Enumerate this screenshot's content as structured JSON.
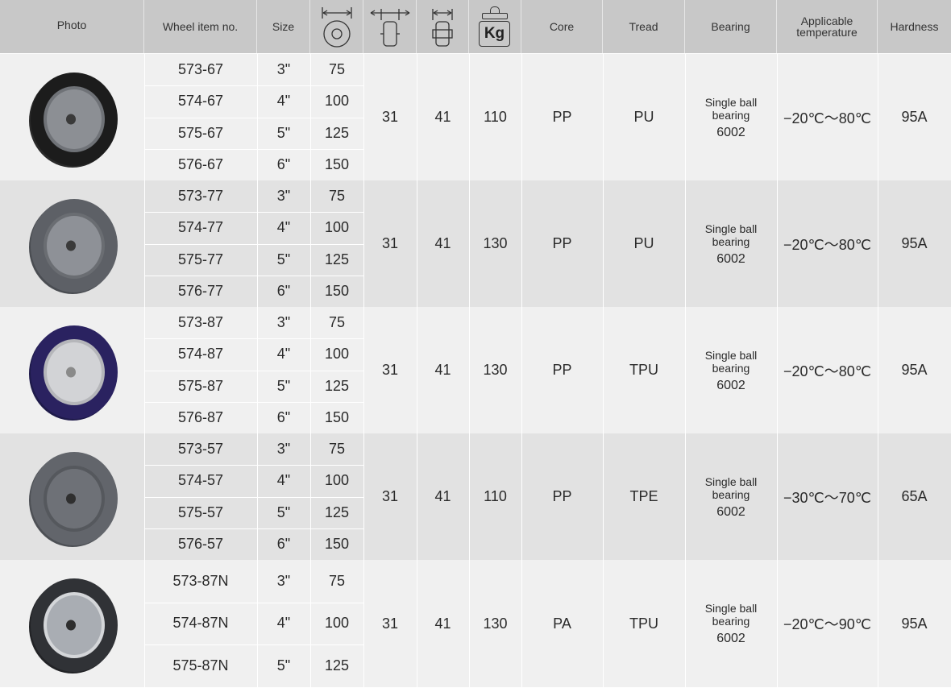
{
  "header": {
    "photo": "Photo",
    "item_no": "Wheel item no.",
    "size": "Size",
    "core": "Core",
    "tread": "Tread",
    "bearing": "Bearing",
    "temp_line1": "Applicable",
    "temp_line2": "temperature",
    "hardness": "Hardness",
    "load_unit": "Kg",
    "icons": [
      "wheel-diameter-icon",
      "overall-width-icon",
      "hub-length-icon",
      "load-weight-icon"
    ]
  },
  "groups": [
    {
      "wheel_style": "black-tread-grey-hub",
      "rows": [
        {
          "item": "573-67",
          "size": "3\"",
          "diameter": "75"
        },
        {
          "item": "574-67",
          "size": "4\"",
          "diameter": "100"
        },
        {
          "item": "575-67",
          "size": "5\"",
          "diameter": "125"
        },
        {
          "item": "576-67",
          "size": "6\"",
          "diameter": "150"
        }
      ],
      "width": "31",
      "hub": "41",
      "load": "110",
      "core": "PP",
      "tread": "PU",
      "bearing_l1": "Single ball",
      "bearing_l2": "bearing",
      "bearing_no": "6002",
      "temperature": "−20℃～80℃",
      "hardness": "95A"
    },
    {
      "wheel_style": "grey-tread-grey-hub",
      "rows": [
        {
          "item": "573-77",
          "size": "3\"",
          "diameter": "75"
        },
        {
          "item": "574-77",
          "size": "4\"",
          "diameter": "100"
        },
        {
          "item": "575-77",
          "size": "5\"",
          "diameter": "125"
        },
        {
          "item": "576-77",
          "size": "6\"",
          "diameter": "150"
        }
      ],
      "width": "31",
      "hub": "41",
      "load": "130",
      "core": "PP",
      "tread": "PU",
      "bearing_l1": "Single ball",
      "bearing_l2": "bearing",
      "bearing_no": "6002",
      "temperature": "−20℃～80℃",
      "hardness": "95A"
    },
    {
      "wheel_style": "blue-tread-white-hub",
      "rows": [
        {
          "item": "573-87",
          "size": "3\"",
          "diameter": "75"
        },
        {
          "item": "574-87",
          "size": "4\"",
          "diameter": "100"
        },
        {
          "item": "575-87",
          "size": "5\"",
          "diameter": "125"
        },
        {
          "item": "576-87",
          "size": "6\"",
          "diameter": "150"
        }
      ],
      "width": "31",
      "hub": "41",
      "load": "130",
      "core": "PP",
      "tread": "TPU",
      "bearing_l1": "Single ball",
      "bearing_l2": "bearing",
      "bearing_no": "6002",
      "temperature": "−20℃～80℃",
      "hardness": "95A"
    },
    {
      "wheel_style": "grey-tread-dark-hub",
      "rows": [
        {
          "item": "573-57",
          "size": "3\"",
          "diameter": "75"
        },
        {
          "item": "574-57",
          "size": "4\"",
          "diameter": "100"
        },
        {
          "item": "575-57",
          "size": "5\"",
          "diameter": "125"
        },
        {
          "item": "576-57",
          "size": "6\"",
          "diameter": "150"
        }
      ],
      "width": "31",
      "hub": "41",
      "load": "110",
      "core": "PP",
      "tread": "TPE",
      "bearing_l1": "Single ball",
      "bearing_l2": "bearing",
      "bearing_no": "6002",
      "temperature": "−30℃～70℃",
      "hardness": "65A"
    },
    {
      "wheel_style": "dark-tread-light-hub",
      "rows": [
        {
          "item": "573-87N",
          "size": "3\"",
          "diameter": "75"
        },
        {
          "item": "574-87N",
          "size": "4\"",
          "diameter": "100"
        },
        {
          "item": "575-87N",
          "size": "5\"",
          "diameter": "125"
        }
      ],
      "width": "31",
      "hub": "41",
      "load": "130",
      "core": "PA",
      "tread": "TPU",
      "bearing_l1": "Single ball",
      "bearing_l2": "bearing",
      "bearing_no": "6002",
      "temperature": "−20℃～90℃",
      "hardness": "95A"
    }
  ],
  "colors": {
    "header_bg": "#c8c8c8",
    "row_light": "#f0f0f0",
    "row_dark": "#e2e2e2",
    "text": "#2a2a2a"
  }
}
